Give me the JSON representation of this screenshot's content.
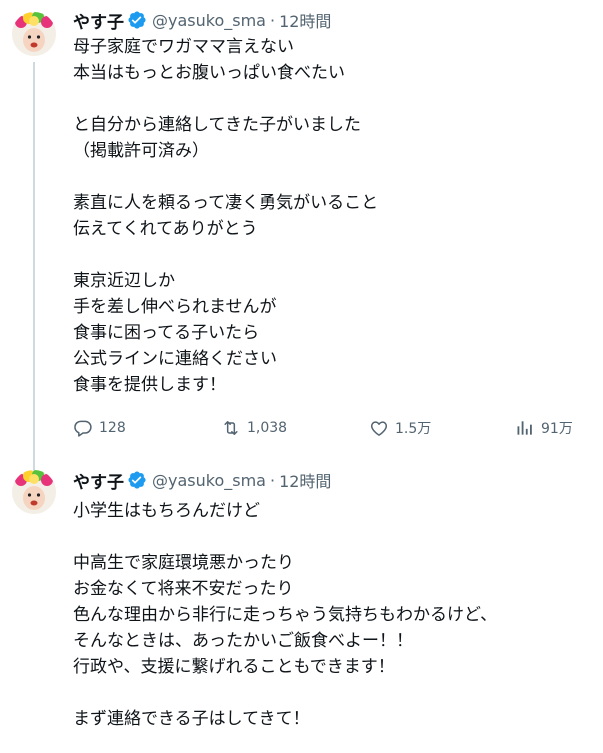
{
  "tweets": [
    {
      "author": {
        "name": "やす子",
        "handle": "@yasuko_sma",
        "separator": "·",
        "time": "12時間"
      },
      "lines": [
        "母子家庭でワガママ言えない",
        "本当はもっとお腹いっぱい食べたい",
        "",
        "と自分から連絡してきた子がいました",
        "（掲載許可済み）",
        "",
        "素直に人を頼るって凄く勇気がいること",
        "伝えてくれてありがとう",
        "",
        "東京近辺しか",
        "手を差し伸べられませんが",
        "食事に困ってる子いたら",
        "公式ラインに連絡ください",
        "食事を提供します！"
      ],
      "metrics": {
        "replies": "128",
        "retweets": "1,038",
        "likes": "1.5万",
        "views": "91万"
      }
    },
    {
      "author": {
        "name": "やす子",
        "handle": "@yasuko_sma",
        "separator": "·",
        "time": "12時間"
      },
      "lines": [
        "小学生はもちろんだけど",
        "",
        "中高生で家庭環境悪かったり",
        "お金なくて将来不安だったり",
        "色んな理由から非行に走っちゃう気持ちもわかるけど、",
        "そんなときは、あったかいご飯食べよー！！",
        "行政や、支援に繋げれることもできます！",
        "",
        "まず連絡できる子はしてきて！"
      ]
    }
  ],
  "icons": {
    "verified": "verified-badge-icon",
    "reply": "reply-icon",
    "retweet": "retweet-icon",
    "like": "heart-icon",
    "views": "views-chart-icon"
  },
  "colors": {
    "text": "#0f1419",
    "secondary": "#536471",
    "verified": "#1d9bf0",
    "thread_line": "#cfd9de"
  }
}
